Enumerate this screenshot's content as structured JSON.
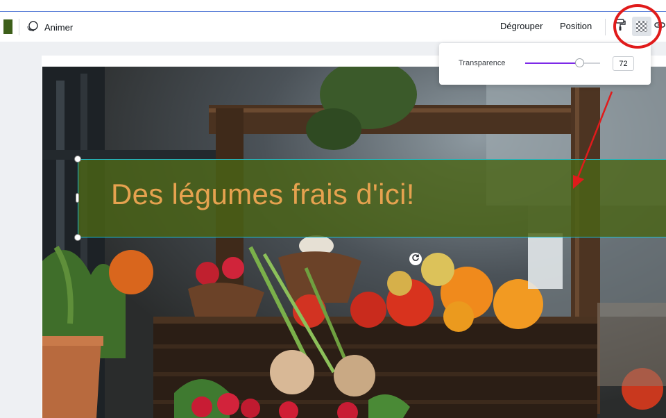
{
  "toolbar": {
    "animate_label": "Animer",
    "ungroup_label": "Dégrouper",
    "position_label": "Position",
    "color_swatch": "#3d5f1a",
    "icons": [
      "animate-icon",
      "paint-roller-icon",
      "transparency-icon",
      "link-icon"
    ]
  },
  "transparency_popover": {
    "label": "Transparence",
    "value": "72",
    "level": 0.72,
    "accent": "#7d2ae8"
  },
  "design": {
    "headline": "Des légumes frais d'ici!",
    "text_color": "#e6a24f",
    "box_color": "#4a6416",
    "selection_color": "#1fc3d6"
  },
  "annotation": {
    "color": "#e01b1b"
  }
}
